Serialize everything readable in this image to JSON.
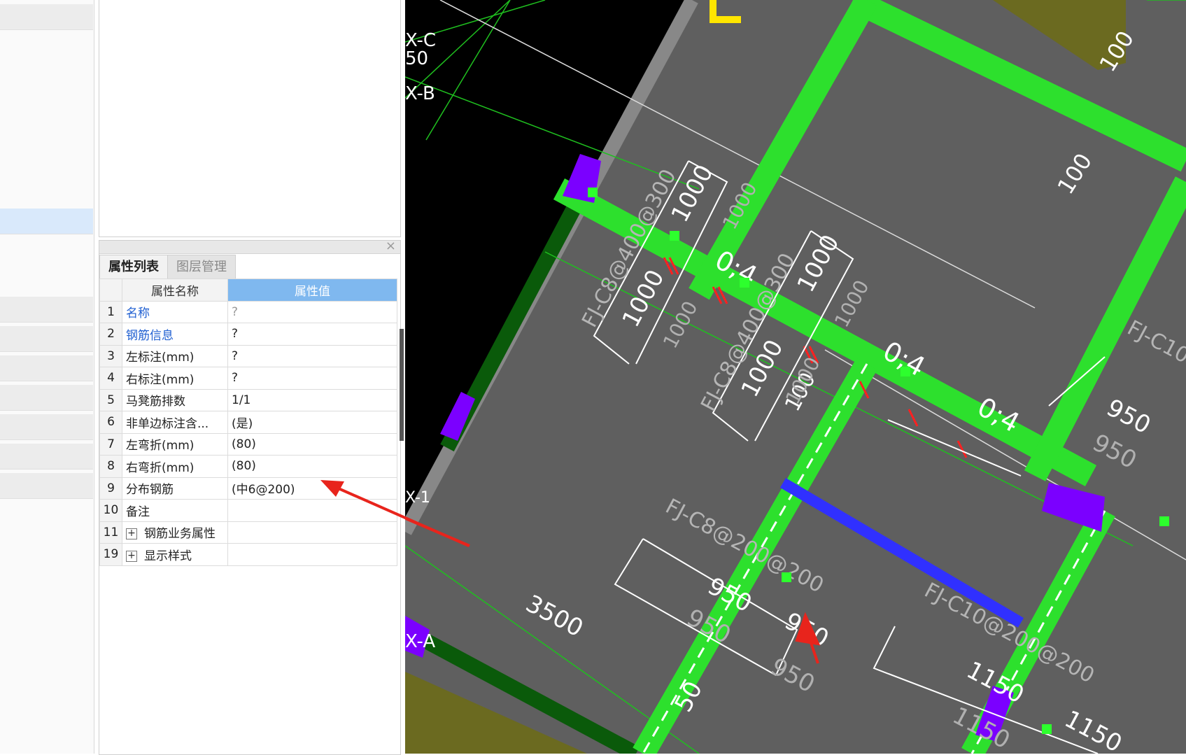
{
  "tabs": {
    "properties": "属性列表",
    "layers": "图层管理"
  },
  "table": {
    "col_name": "属性名称",
    "col_value": "属性值",
    "rows": [
      {
        "num": "1",
        "name": "名称",
        "value": "?",
        "expand": ""
      },
      {
        "num": "2",
        "name": "钢筋信息",
        "value": "?",
        "expand": ""
      },
      {
        "num": "3",
        "name": "左标注(mm)",
        "value": "?",
        "expand": ""
      },
      {
        "num": "4",
        "name": "右标注(mm)",
        "value": "?",
        "expand": ""
      },
      {
        "num": "5",
        "name": "马凳筋排数",
        "value": "1/1",
        "expand": ""
      },
      {
        "num": "6",
        "name": "非单边标注含...",
        "value": "(是)",
        "expand": ""
      },
      {
        "num": "7",
        "name": "左弯折(mm)",
        "value": "(80)",
        "expand": ""
      },
      {
        "num": "8",
        "name": "右弯折(mm)",
        "value": "(80)",
        "expand": ""
      },
      {
        "num": "9",
        "name": "分布钢筋",
        "value": "(中6@200)",
        "expand": ""
      },
      {
        "num": "10",
        "name": "备注",
        "value": "",
        "expand": ""
      },
      {
        "num": "11",
        "name": "钢筋业务属性",
        "value": "",
        "expand": "+"
      },
      {
        "num": "19",
        "name": "显示样式",
        "value": "",
        "expand": "+"
      }
    ]
  },
  "close_symbol": "×",
  "cad": {
    "axis_labels": [
      "X-C",
      "50",
      "X-B",
      "X-1",
      "X-A"
    ],
    "dims": {
      "d100a": "100",
      "d100b": "100",
      "d100c": "100",
      "d1000a": "1000",
      "d1000b": "1000",
      "d1000c": "1000",
      "d1000d": "1000",
      "d1000e": "1000",
      "d1000f": "1000",
      "d1000g": "1000",
      "d1000h": "1000",
      "ratio1": "0;4",
      "ratio2": "0;4",
      "ratio3": "0;4",
      "d950a": "950",
      "d950b": "950",
      "d950c": "950",
      "d950d": "950",
      "d950e": "950",
      "d950f": "950",
      "d1150a": "1150",
      "d1150b": "1150",
      "d1150c": "1150",
      "d3500": "3500",
      "d50": "50"
    },
    "rebar_labels": {
      "r1": "FJ-C8@400@300",
      "r2": "FJ-C8@400@300",
      "r3": "FJ-C8@200@200",
      "r4": "FJ-C10@200@200",
      "r5": "FJ-C10"
    },
    "colors": {
      "slab": "#5f5f5f",
      "beam": "#2de02d",
      "support": "#7b00ff",
      "dim": "#ffffff",
      "arrow": "#e8241c"
    }
  }
}
